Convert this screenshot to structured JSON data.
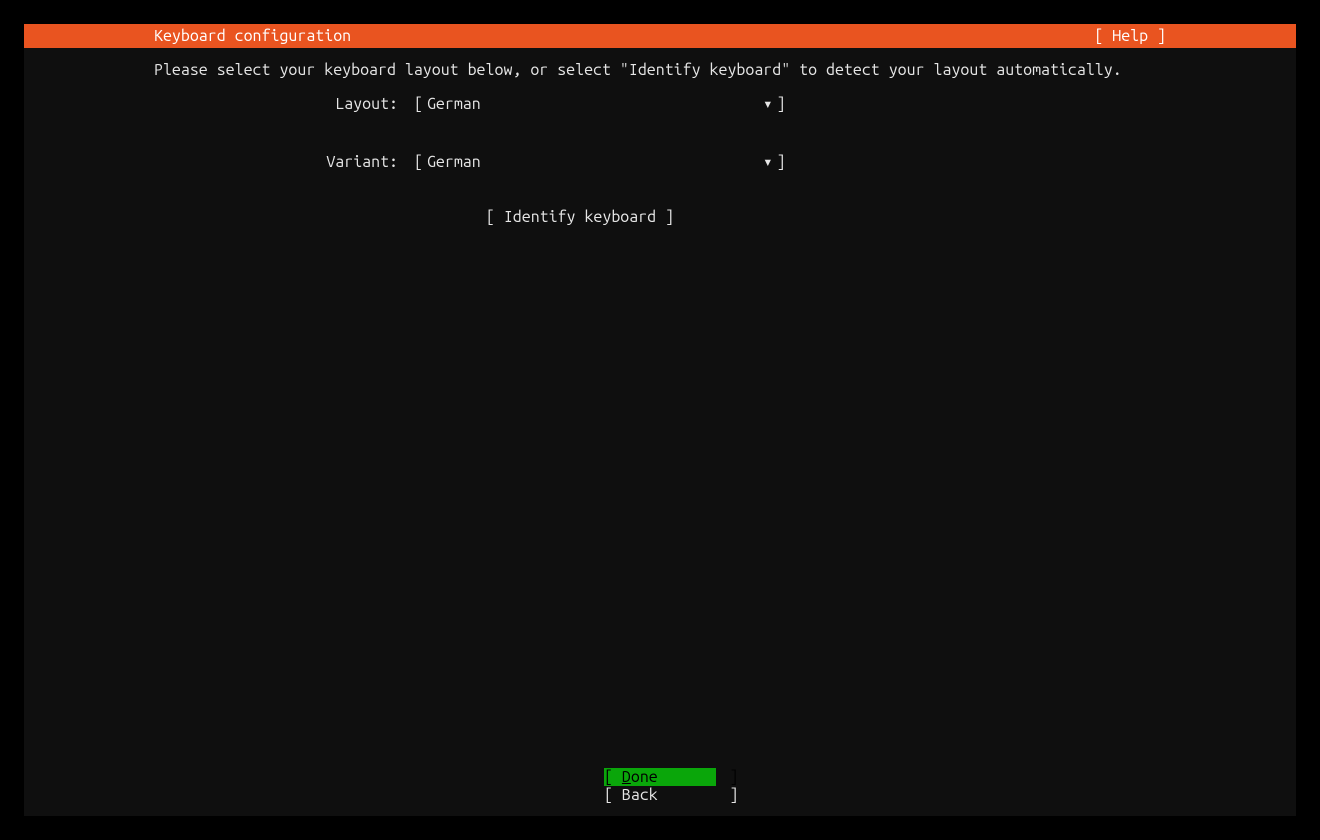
{
  "header": {
    "title": "Keyboard configuration",
    "help": "[ Help ]"
  },
  "instruction": "Please select your keyboard layout below, or select \"Identify keyboard\" to detect your layout automatically.",
  "form": {
    "layout_label": "Layout:",
    "layout_value": "German",
    "variant_label": "Variant:",
    "variant_value": "German",
    "bracket_open": "[",
    "bracket_close": "]",
    "arrow": "▾"
  },
  "identify_button": "[ Identify keyboard ]",
  "footer": {
    "done_open": "[ ",
    "done_char": "D",
    "done_rest": "one",
    "done_close": "]",
    "back": "[ Back        ]"
  }
}
